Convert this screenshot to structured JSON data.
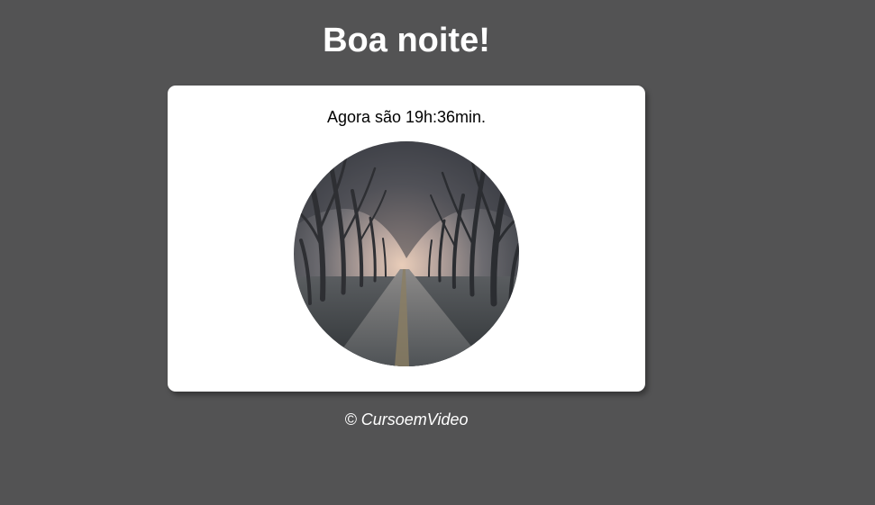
{
  "header": {
    "title": "Boa noite!"
  },
  "card": {
    "time_text": "Agora são 19h:36min."
  },
  "footer": {
    "copyright": "© CursoemVideo"
  },
  "colors": {
    "background": "#535354",
    "card": "#ffffff",
    "title_text": "#ffffff",
    "body_text": "#000000"
  }
}
